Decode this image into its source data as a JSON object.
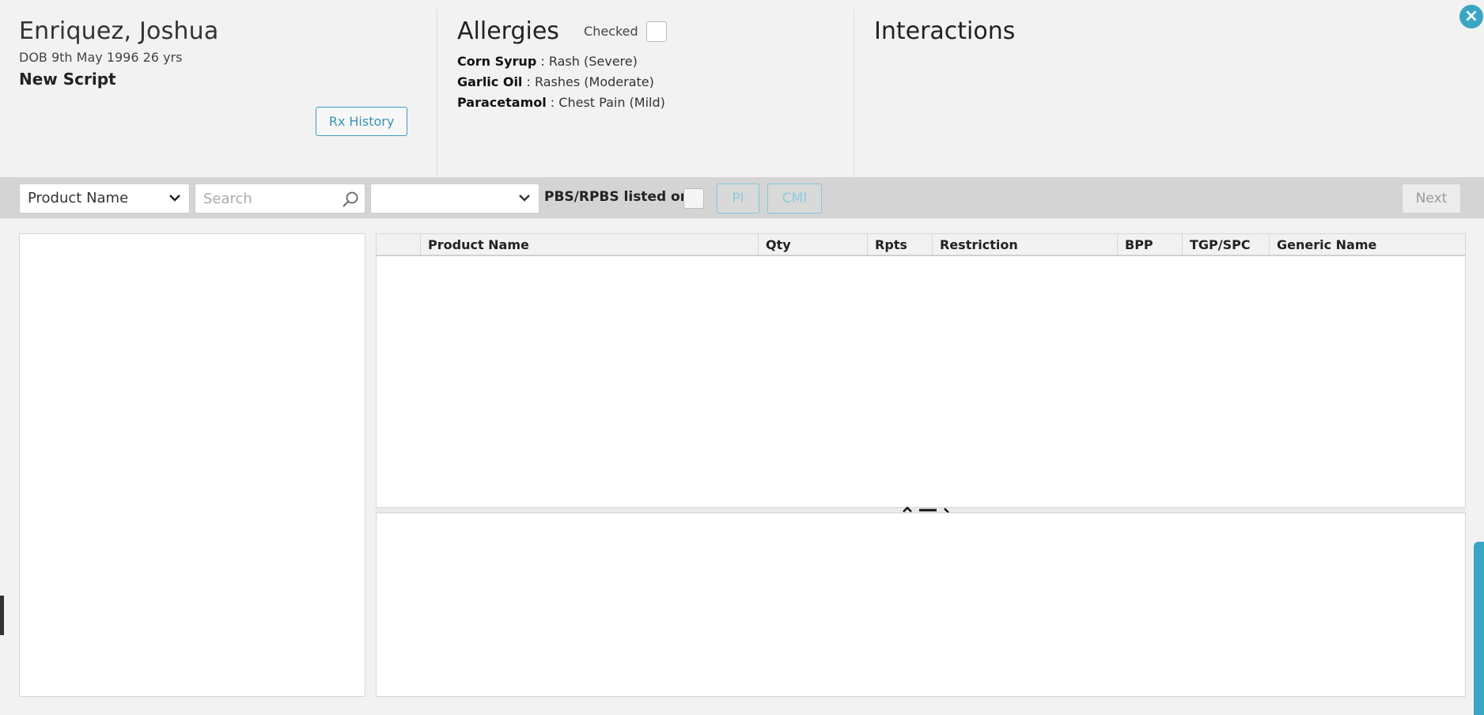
{
  "patient": {
    "name": "Enriquez, Joshua",
    "dob": "DOB 9th May 1996 26 yrs",
    "script_title": "New Script",
    "rx_history_label": "Rx History"
  },
  "allergies": {
    "title": "Allergies",
    "checked_label": "Checked",
    "items": [
      {
        "name": "Corn Syrup",
        "detail": " : Rash (Severe)"
      },
      {
        "name": "Garlic Oil",
        "detail": " : Rashes (Moderate)"
      },
      {
        "name": "Paracetamol",
        "detail": " : Chest Pain (Mild)"
      }
    ]
  },
  "interactions": {
    "title": "Interactions"
  },
  "toolbar": {
    "product_select_value": "Product Name",
    "search_placeholder": "Search",
    "secondary_select_value": "",
    "pbs_label": "PBS/RPBS listed only",
    "pi_label": "PI",
    "cmi_label": "CMI",
    "next_label": "Next"
  },
  "table": {
    "columns": [
      "",
      "Product Name",
      "Qty",
      "Rpts",
      "Restriction",
      "BPP",
      "TGP/SPC",
      "Generic Name"
    ]
  },
  "colors": {
    "accent": "#3aa6c3",
    "toolbar_bg": "#d4d4d4",
    "page_bg": "#f2f2f2"
  }
}
